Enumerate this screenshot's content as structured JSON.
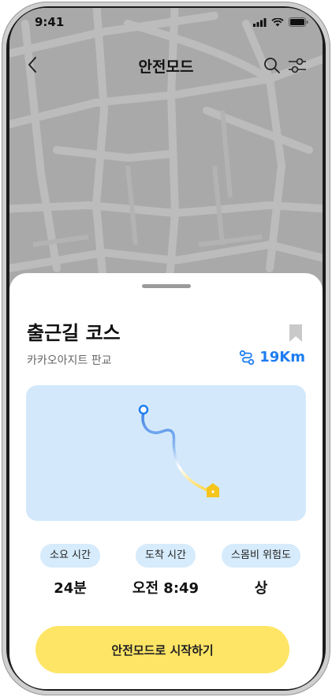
{
  "status_bar": {
    "time": "9:41"
  },
  "nav": {
    "title": "안전모드"
  },
  "sheet": {
    "course_title": "출근길 코스",
    "place": "카카오아지트 판교",
    "distance": "19Km"
  },
  "stats": [
    {
      "label": "소요 시간",
      "value": "24분"
    },
    {
      "label": "도착 시간",
      "value": "오전 8:49"
    },
    {
      "label": "스몸비 위험도",
      "value": "상"
    }
  ],
  "cta": {
    "label": "안전모드로 시작하기"
  },
  "colors": {
    "accent_blue": "#1e7df0",
    "cta_yellow": "#fee565",
    "card_blue": "#d3e9fb"
  }
}
